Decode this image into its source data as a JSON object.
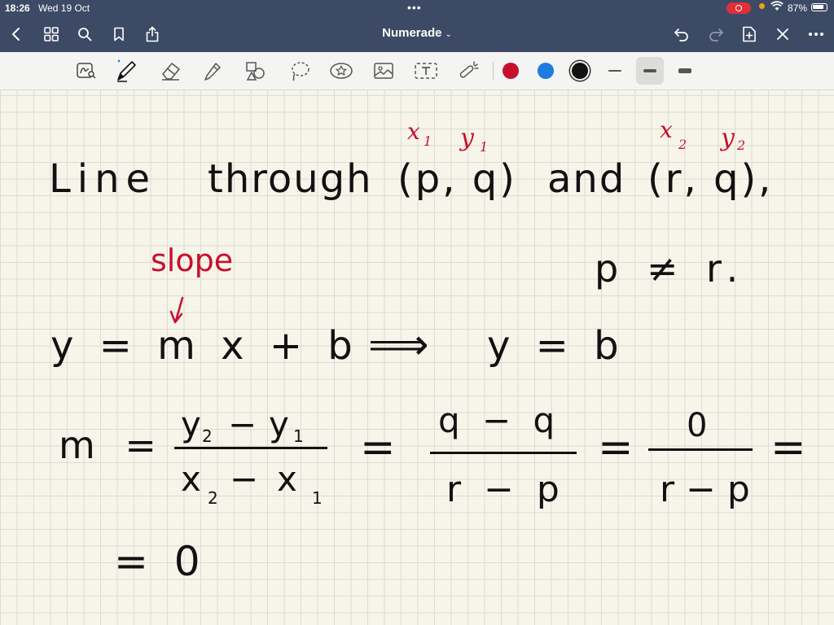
{
  "status": {
    "time": "18:26",
    "date": "Wed 19 Oct",
    "battery": "87%",
    "battery_level": 0.87
  },
  "nav": {
    "title": "Numerade"
  },
  "toolbar": {
    "tools": [
      "lasso-read-icon",
      "pen-icon",
      "eraser-icon",
      "highlighter-icon",
      "shapes-icon",
      "lasso-icon",
      "sticker-icon",
      "image-icon",
      "text-icon",
      "laser-icon"
    ],
    "colors": [
      "#c8102e",
      "#1e7be0",
      "#111111"
    ],
    "selected_color": "#111111",
    "stroke_widths": [
      "thin",
      "medium",
      "thick"
    ],
    "selected_stroke": "medium"
  },
  "note": {
    "line1": {
      "text1": "Line",
      "text2": "through",
      "pt1": "(p, q)",
      "and": "and",
      "pt2": "(r, q),",
      "ann_x1": "x",
      "ann_x1_sub": "1",
      "ann_y1": "y",
      "ann_y1_sub": "1",
      "ann_x2": "x",
      "ann_x2_sub": "2",
      "ann_y2": "y",
      "ann_y2_sub": "2"
    },
    "slope_label": "slope",
    "condition": "p ≠ r.",
    "eq1": {
      "lhs": "y = m x + b",
      "arrow": "⟹",
      "rhs": "y = b"
    },
    "eq2": {
      "m": "m =",
      "num1": "y",
      "num1_sub2": "2",
      "minus1": "−",
      "num1b": "y",
      "num1_sub1": "1",
      "den1": "x",
      "den1_sub2": "2",
      "minus2": "−",
      "den1b": "x",
      "den1_sub1": "1",
      "eq_a": "=",
      "num2": "q − q",
      "den2": "r − p",
      "eq_b": "=",
      "num3": "0",
      "den3": "r − p",
      "eq_c": "="
    },
    "eq3": "= 0"
  }
}
